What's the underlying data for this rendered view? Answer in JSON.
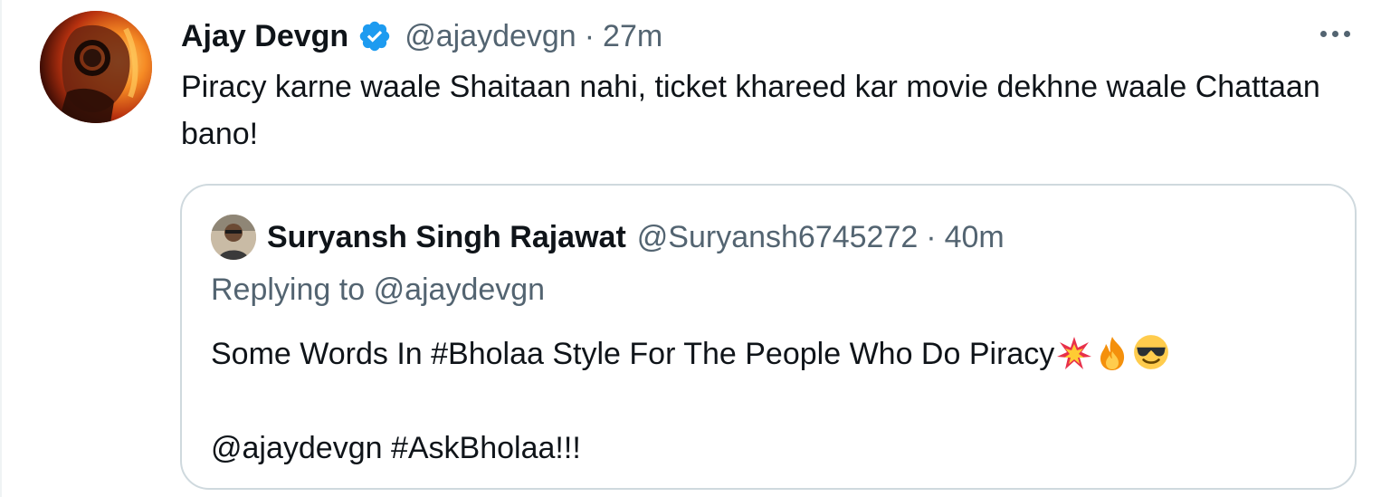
{
  "tweet": {
    "author_name": "Ajay Devgn",
    "author_handle": "@ajaydevgn",
    "separator": "·",
    "time": "27m",
    "text": "Piracy karne waale Shaitaan nahi, ticket khareed kar movie dekhne waale Chattaan bano!",
    "more_icon": "more-horizontal-icon",
    "verified_icon": "verified-badge-icon",
    "verified_color": "#1d9bf0"
  },
  "quote": {
    "author_name": "Suryansh Singh Rajawat",
    "author_handle": "@Suryansh6745272",
    "separator": "·",
    "time": "40m",
    "replying_prefix": "Replying to",
    "replying_mention": "@ajaydevgn",
    "line1": "Some Words In #Bholaa Style For The People Who Do Piracy",
    "line1_emojis": [
      "collision-icon",
      "fire-icon",
      "sunglasses-face-icon"
    ],
    "line2": "@ajaydevgn #AskBholaa!!!"
  },
  "colors": {
    "text_primary": "#0f1419",
    "text_secondary": "#536471",
    "border": "#cfd9de",
    "accent": "#1d9bf0"
  }
}
